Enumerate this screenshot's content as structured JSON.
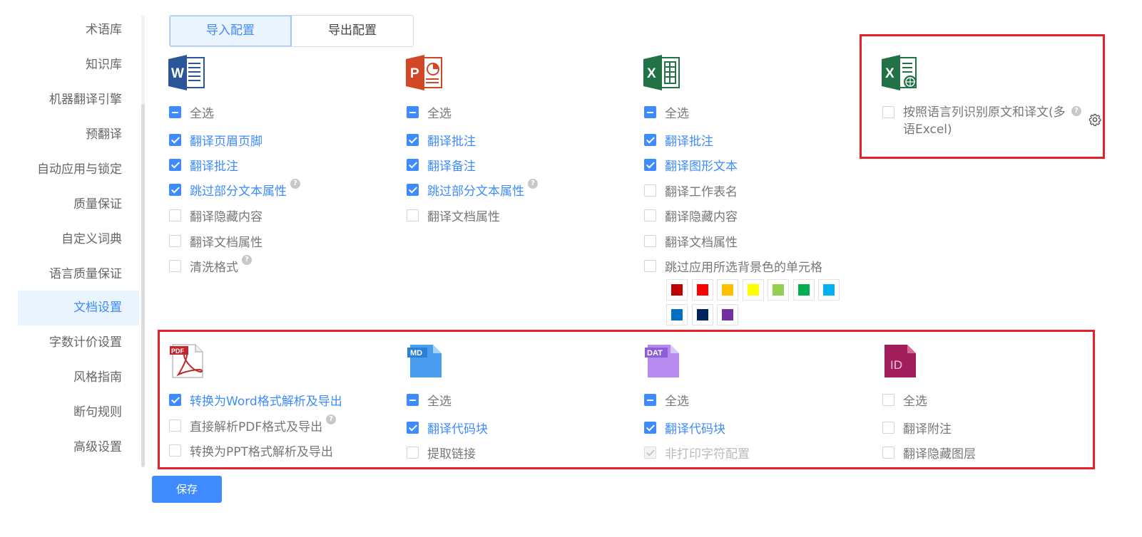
{
  "sidebar": {
    "items": [
      {
        "label": "术语库"
      },
      {
        "label": "知识库"
      },
      {
        "label": "机器翻译引擎"
      },
      {
        "label": "预翻译"
      },
      {
        "label": "自动应用与锁定"
      },
      {
        "label": "质量保证"
      },
      {
        "label": "自定义词典"
      },
      {
        "label": "语言质量保证"
      },
      {
        "label": "文档设置",
        "active": true
      },
      {
        "label": "字数计价设置"
      },
      {
        "label": "风格指南"
      },
      {
        "label": "断句规则"
      },
      {
        "label": "高级设置"
      }
    ]
  },
  "tabs": [
    {
      "label": "导入配置",
      "active": true
    },
    {
      "label": "导出配置"
    }
  ],
  "word": {
    "icon": "word-icon",
    "options": [
      {
        "label": "全选",
        "state": "partial"
      },
      {
        "label": "翻译页眉页脚",
        "state": "checked"
      },
      {
        "label": "翻译批注",
        "state": "checked"
      },
      {
        "label": "跳过部分文本属性",
        "state": "checked",
        "help": "?"
      },
      {
        "label": "翻译隐藏内容",
        "state": "unchecked"
      },
      {
        "label": "翻译文档属性",
        "state": "unchecked"
      },
      {
        "label": "清洗格式",
        "state": "unchecked",
        "help": "?"
      }
    ]
  },
  "ppt": {
    "icon": "powerpoint-icon",
    "options": [
      {
        "label": "全选",
        "state": "partial"
      },
      {
        "label": "翻译批注",
        "state": "checked"
      },
      {
        "label": "翻译备注",
        "state": "checked"
      },
      {
        "label": "跳过部分文本属性",
        "state": "checked",
        "help": "?"
      },
      {
        "label": "翻译文档属性",
        "state": "unchecked"
      }
    ]
  },
  "excel": {
    "icon": "excel-icon",
    "options": [
      {
        "label": "全选",
        "state": "partial"
      },
      {
        "label": "翻译批注",
        "state": "checked"
      },
      {
        "label": "翻译图形文本",
        "state": "checked"
      },
      {
        "label": "翻译工作表名",
        "state": "unchecked"
      },
      {
        "label": "翻译隐藏内容",
        "state": "unchecked"
      },
      {
        "label": "翻译文档属性",
        "state": "unchecked"
      },
      {
        "label": "跳过应用所选背景色的单元格",
        "state": "unchecked"
      }
    ],
    "swatch_colors": [
      "#c00000",
      "#ff0000",
      "#ffc000",
      "#ffff00",
      "#92d050",
      "#00b050",
      "#00b0f0",
      "#0070c0",
      "#002060",
      "#7030a0"
    ]
  },
  "multi_excel": {
    "icon": "multilingual-excel-icon",
    "label": "按照语言列识别原文和译文(多语Excel)",
    "state": "unchecked",
    "help": "?"
  },
  "pdf": {
    "icon": "pdf-icon",
    "icon_text": "PDF",
    "options": [
      {
        "label": "转换为Word格式解析及导出",
        "state": "checked"
      },
      {
        "label": "直接解析PDF格式及导出",
        "state": "unchecked",
        "help": "?"
      },
      {
        "label": "转换为PPT格式解析及导出",
        "state": "unchecked"
      }
    ]
  },
  "md": {
    "icon": "markdown-icon",
    "icon_text": "MD",
    "options": [
      {
        "label": "全选",
        "state": "partial"
      },
      {
        "label": "翻译代码块",
        "state": "checked"
      },
      {
        "label": "提取链接",
        "state": "unchecked"
      }
    ]
  },
  "dat": {
    "icon": "dat-icon",
    "icon_text": "DAT",
    "options": [
      {
        "label": "全选",
        "state": "partial"
      },
      {
        "label": "翻译代码块",
        "state": "checked"
      },
      {
        "label": "非打印字符配置",
        "state": "disabled-checked"
      }
    ]
  },
  "indesign": {
    "icon": "indesign-icon",
    "icon_text": "ID",
    "options": [
      {
        "label": "全选",
        "state": "unchecked"
      },
      {
        "label": "翻译附注",
        "state": "unchecked"
      },
      {
        "label": "翻译隐藏图层",
        "state": "unchecked"
      }
    ]
  },
  "save_label": "保存",
  "colors": {
    "accent": "#3d8bff",
    "highlight_border": "#e8202a"
  }
}
